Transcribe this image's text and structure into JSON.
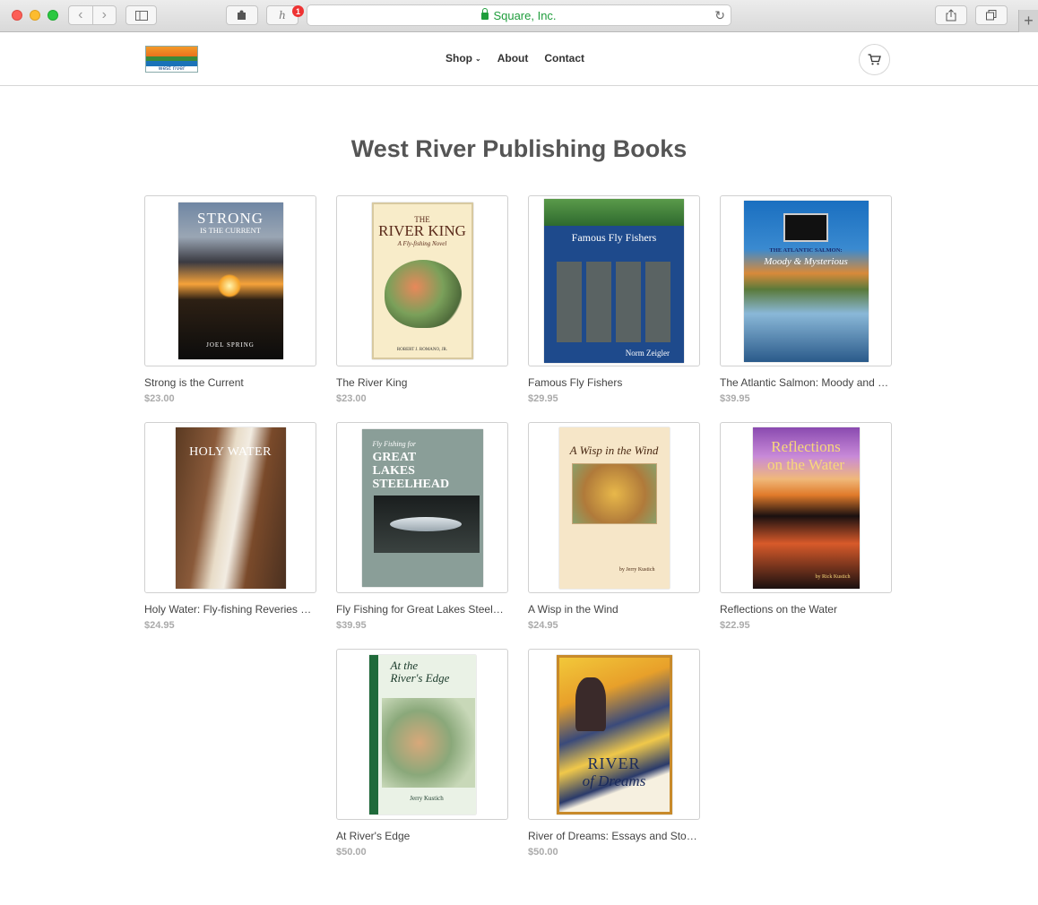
{
  "browser": {
    "address_text": "Square, Inc.",
    "badge_count": "1"
  },
  "header": {
    "logo_text": "west river",
    "nav": [
      {
        "label": "Shop"
      },
      {
        "label": "About"
      },
      {
        "label": "Contact"
      }
    ]
  },
  "page_title": "West River Publishing Books",
  "products": [
    {
      "name": "Strong is the Current",
      "price": "$23.00",
      "cover_title": "STRONG",
      "cover_title2": "IS THE CURRENT",
      "cover_author": "JOEL SPRING"
    },
    {
      "name": "The River King",
      "price": "$23.00",
      "cover_title": "THE",
      "cover_title2": "RIVER KING",
      "cover_sub": "A Fly-fishing Novel",
      "cover_author": "ROBERT J. ROMANO, JR."
    },
    {
      "name": "Famous Fly Fishers",
      "price": "$29.95",
      "cover_title": "Famous Fly Fishers",
      "cover_author": "Norm Zeigler"
    },
    {
      "name": "The Atlantic Salmon: Moody and Mysterious",
      "price": "$39.95",
      "cover_title": "THE ATLANTIC SALMON:",
      "cover_title2": "Moody & Mysterious"
    },
    {
      "name": "Holy Water: Fly-fishing Reveries and Ruminations",
      "price": "$24.95",
      "cover_title": "HOLY WATER"
    },
    {
      "name": "Fly Fishing for Great Lakes Steelhead",
      "price": "$39.95",
      "cover_title": "Fly Fishing for",
      "cover_title2": "GREAT LAKES STEELHEAD"
    },
    {
      "name": "A Wisp in the Wind",
      "price": "$24.95",
      "cover_title": "A Wisp in the Wind",
      "cover_author": "by Jerry Kustich"
    },
    {
      "name": "Reflections on the Water",
      "price": "$22.95",
      "cover_title": "Reflections",
      "cover_title2": "on the Water",
      "cover_author": "by Rick Kustich"
    },
    {
      "name": "At River's Edge",
      "price": "$50.00",
      "cover_title": "At the",
      "cover_title2": "River's Edge",
      "cover_author": "Jerry Kustich"
    },
    {
      "name": "River of Dreams: Essays and Stories",
      "price": "$50.00",
      "cover_title": "RIVER",
      "cover_title2": "of Dreams"
    }
  ],
  "colors": {
    "accent_green": "#1f9d3c",
    "price_gray": "#aaaaaa",
    "title_gray": "#555555"
  }
}
